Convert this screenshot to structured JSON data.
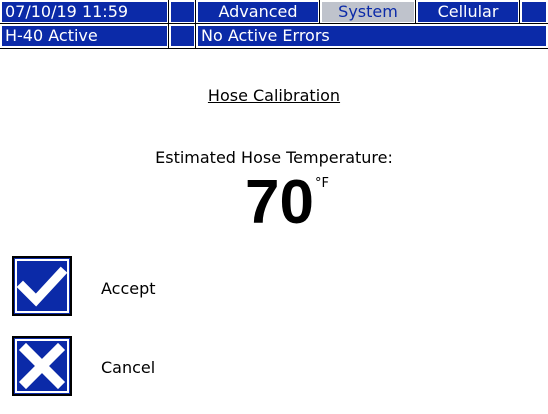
{
  "status_bar": {
    "datetime": "07/10/19 11:59",
    "mode": "H-40 Active",
    "errors": "No Active Errors"
  },
  "tabs": [
    {
      "label": "Advanced",
      "selected": false
    },
    {
      "label": "System",
      "selected": true
    },
    {
      "label": "Cellular",
      "selected": false
    }
  ],
  "screen": {
    "title": "Hose Calibration",
    "temp_label": "Estimated Hose Temperature:",
    "temp_value": "70",
    "temp_unit": "°F"
  },
  "actions": {
    "accept_label": "Accept",
    "cancel_label": "Cancel",
    "accept_icon": "checkmark-icon",
    "cancel_icon": "x-icon"
  },
  "colors": {
    "bar_blue": "#0b2aa8",
    "selected_tab": "#bfc3cc"
  }
}
